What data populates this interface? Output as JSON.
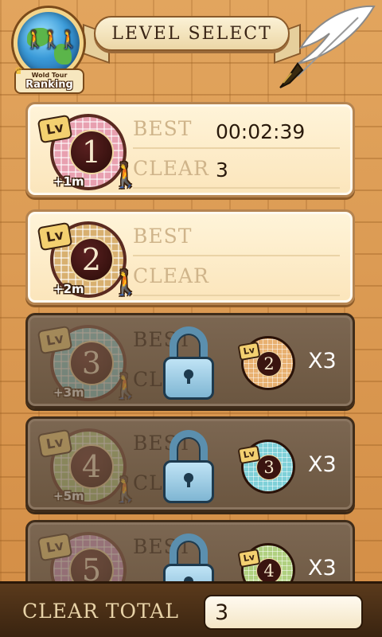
{
  "header": {
    "title": "LEVEL SELECT",
    "ranking": {
      "small_text": "Wold Tour",
      "label": "Ranking"
    }
  },
  "labels": {
    "best": "BEST",
    "clear": "CLEAR"
  },
  "levels": [
    {
      "lv": "Lv",
      "number": "1",
      "time_bonus": "+1m",
      "best_time": "00:02:39",
      "clear_count": "3",
      "locked": false,
      "color": "#e8a0b0"
    },
    {
      "lv": "Lv",
      "number": "2",
      "time_bonus": "+2m",
      "best_time": "",
      "clear_count": "",
      "locked": false,
      "color": "#d8b070"
    },
    {
      "lv": "Lv",
      "number": "3",
      "time_bonus": "+3m",
      "locked": true,
      "color": "#7fd0d8",
      "requirement": {
        "lv": "Lv",
        "number": "2",
        "count": "X3",
        "color": "#e8b070"
      }
    },
    {
      "lv": "Lv",
      "number": "4",
      "time_bonus": "+5m",
      "locked": true,
      "color": "#b0d080",
      "requirement": {
        "lv": "Lv",
        "number": "3",
        "count": "X3",
        "color": "#7fd0d8"
      }
    },
    {
      "lv": "Lv",
      "number": "5",
      "time_bonus": "",
      "locked": true,
      "color": "#d090c8",
      "requirement": {
        "lv": "Lv",
        "number": "4",
        "count": "X3",
        "color": "#b0d080"
      }
    }
  ],
  "footer": {
    "label": "CLEAR TOTAL",
    "value": "3"
  },
  "icons": {
    "runner": "walking-person-icon",
    "lock": "padlock-icon",
    "quill": "quill-pen-icon",
    "globe": "globe-icon"
  }
}
